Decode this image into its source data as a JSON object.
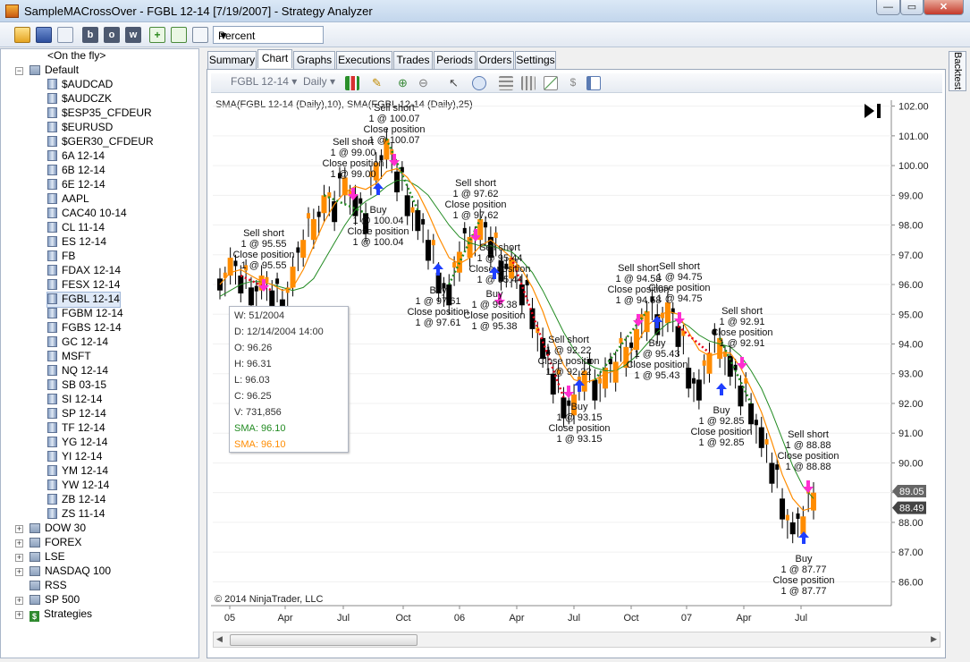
{
  "window": {
    "title": "SampleMACrossOver - FGBL 12-14 [7/19/2007] - Strategy Analyzer"
  },
  "toolbar": {
    "mode_select": "Percent",
    "b": "b",
    "o": "o",
    "w": "w"
  },
  "tree": {
    "on_the_fly": "<On the fly>",
    "default_label": "Default",
    "instruments": [
      "$AUDCAD",
      "$AUDCZK",
      "$ESP35_CFDEUR",
      "$EURUSD",
      "$GER30_CFDEUR",
      "6A 12-14",
      "6B 12-14",
      "6E 12-14",
      "AAPL",
      "CAC40 10-14",
      "CL 11-14",
      "ES 12-14",
      "FB",
      "FDAX 12-14",
      "FESX 12-14",
      "FGBL 12-14",
      "FGBM 12-14",
      "FGBS 12-14",
      "GC 12-14",
      "MSFT",
      "NQ 12-14",
      "SB 03-15",
      "SI 12-14",
      "SP 12-14",
      "TF 12-14",
      "YG 12-14",
      "YI 12-14",
      "YM 12-14",
      "YW 12-14",
      "ZB 12-14",
      "ZS 11-14"
    ],
    "groups": [
      "DOW 30",
      "FOREX",
      "LSE",
      "NASDAQ 100",
      "RSS",
      "SP 500",
      "Strategies"
    ],
    "selected": "FGBL 12-14"
  },
  "tabs": [
    "Summary",
    "Chart",
    "Graphs",
    "Executions",
    "Trades",
    "Periods",
    "Orders",
    "Settings"
  ],
  "active_tab": "Chart",
  "side_tab": "Backtest",
  "chart_toolbar": {
    "instrument": "FGBL 12-14",
    "interval": "Daily"
  },
  "chart_data": {
    "type": "line",
    "title": "SMA(FGBL 12-14 (Daily),10), SMA(FGBL 12-14 (Daily),25)",
    "copyright": "© 2014 NinjaTrader, LLC",
    "x_ticks": [
      "05",
      "Apr",
      "Jul",
      "Oct",
      "06",
      "Apr",
      "Jul",
      "Oct",
      "07",
      "Apr",
      "Jul"
    ],
    "y_ticks": [
      "102.00",
      "101.00",
      "100.00",
      "99.00",
      "98.00",
      "97.00",
      "96.00",
      "95.00",
      "94.00",
      "93.00",
      "92.00",
      "91.00",
      "90.00",
      "89.00",
      "88.00",
      "87.00",
      "86.00"
    ],
    "ylim": [
      85.5,
      102.5
    ],
    "price_markers": [
      "89.05",
      "88.49"
    ],
    "price": [
      96.2,
      96.9,
      96.3,
      95.9,
      96.3,
      95.8,
      95.5,
      96.6,
      97.5,
      98.2,
      99.0,
      98.8,
      99.6,
      99.0,
      98.4,
      100.1,
      100.9,
      99.8,
      99.0,
      98.5,
      97.5,
      96.4,
      96.0,
      97.1,
      97.6,
      98.2,
      97.6,
      96.8,
      96.9,
      96.0,
      95.2,
      94.2,
      93.0,
      92.2,
      92.3,
      93.1,
      92.8,
      93.2,
      93.4,
      93.9,
      94.5,
      95.1,
      95.0,
      95.4,
      94.6,
      93.2,
      92.8,
      93.7,
      94.2,
      93.6,
      92.6,
      92.0,
      91.2,
      90.0,
      88.8,
      88.0,
      88.2,
      89.0
    ],
    "price_ymin": [
      95.8,
      96.3,
      95.7,
      95.3,
      95.8,
      95.2,
      94.9,
      95.9,
      96.9,
      97.5,
      98.4,
      98.1,
      99.0,
      98.3,
      97.7,
      99.5,
      100.2,
      99.1,
      98.3,
      97.8,
      96.8,
      95.7,
      95.3,
      96.4,
      96.9,
      97.5,
      96.9,
      96.1,
      96.2,
      95.3,
      94.5,
      93.5,
      92.3,
      91.5,
      91.6,
      92.4,
      92.1,
      92.5,
      92.7,
      93.2,
      93.8,
      94.4,
      94.3,
      94.7,
      93.9,
      92.5,
      92.1,
      93.0,
      93.5,
      92.9,
      91.9,
      91.3,
      90.5,
      89.3,
      88.1,
      87.6,
      87.6,
      88.4
    ],
    "sma_10": [
      96.0,
      96.4,
      96.5,
      96.3,
      96.1,
      96.0,
      95.8,
      95.9,
      96.5,
      97.3,
      98.1,
      98.7,
      99.1,
      99.3,
      99.2,
      99.4,
      99.8,
      99.9,
      99.6,
      99.1,
      98.4,
      97.6,
      96.9,
      96.7,
      96.9,
      97.3,
      97.5,
      97.2,
      96.9,
      96.5,
      95.9,
      95.1,
      94.1,
      93.3,
      92.8,
      92.7,
      92.8,
      93.0,
      93.1,
      93.5,
      94.0,
      94.6,
      94.9,
      95.1,
      95.0,
      94.4,
      93.8,
      93.6,
      93.7,
      93.7,
      93.2,
      92.5,
      91.7,
      90.7,
      89.6,
      88.8,
      88.4,
      88.5
    ],
    "sma_25": [
      95.6,
      95.8,
      96.0,
      96.1,
      96.1,
      96.0,
      95.9,
      95.8,
      95.9,
      96.2,
      96.8,
      97.4,
      98.0,
      98.5,
      98.8,
      99.0,
      99.3,
      99.5,
      99.5,
      99.3,
      99.0,
      98.5,
      98.0,
      97.6,
      97.4,
      97.3,
      97.3,
      97.2,
      97.1,
      96.8,
      96.4,
      95.8,
      95.1,
      94.4,
      93.8,
      93.4,
      93.2,
      93.1,
      93.1,
      93.3,
      93.6,
      94.0,
      94.4,
      94.7,
      94.8,
      94.6,
      94.3,
      94.1,
      94.0,
      93.9,
      93.6,
      93.1,
      92.5,
      91.7,
      90.8,
      89.9,
      89.2,
      88.8
    ],
    "signals": [
      {
        "lines": [
          "Sell short",
          "1 @ 95.55",
          "Close position",
          "1 @ 95.55"
        ]
      },
      {
        "lines": [
          "Sell short",
          "1 @ 99.00",
          "Close position",
          "1 @ 99.00"
        ]
      },
      {
        "lines": [
          "Sell short",
          "1 @ 100.07",
          "Close position",
          "1 @ 100.07"
        ]
      },
      {
        "lines": [
          "Buy",
          "1 @ 100.04",
          "Close position",
          "1 @ 100.04"
        ]
      },
      {
        "lines": [
          "Sell short",
          "1 @ 97.62",
          "Close position",
          "1 @ 97.62"
        ]
      },
      {
        "lines": [
          "Buy",
          "1 @ 97.61",
          "Close position",
          "1 @ 97.61"
        ]
      },
      {
        "lines": [
          "Sell short",
          "1 @ 95.44",
          "Close position",
          "1 @ 95.44"
        ]
      },
      {
        "lines": [
          "Buy",
          "1 @ 95.38",
          "Close position",
          "1 @ 95.38"
        ]
      },
      {
        "lines": [
          "Sell short",
          "1 @ 92.22",
          "Close position",
          "1 @ 92.22"
        ]
      },
      {
        "lines": [
          "Buy",
          "1 @ 93.15",
          "Close position",
          "1 @ 93.15"
        ]
      },
      {
        "lines": [
          "Sell short",
          "1 @ 94.58",
          "Close position",
          "1 @ 94.58"
        ]
      },
      {
        "lines": [
          "Sell short",
          "1 @ 94.75",
          "Close position",
          "1 @ 94.75"
        ]
      },
      {
        "lines": [
          "Buy",
          "1 @ 95.43",
          "Close position",
          "1 @ 95.43"
        ]
      },
      {
        "lines": [
          "Sell short",
          "1 @ 92.91",
          "Close position",
          "1 @ 92.91"
        ]
      },
      {
        "lines": [
          "Buy",
          "1 @ 92.85",
          "Close position",
          "1 @ 92.85"
        ]
      },
      {
        "lines": [
          "Sell short",
          "1 @ 88.88",
          "Close position",
          "1 @ 88.88"
        ]
      },
      {
        "lines": [
          "Buy",
          "1 @ 87.77",
          "Close position",
          "1 @ 87.77"
        ]
      }
    ]
  },
  "tooltip": {
    "w": "W: 51/2004",
    "d": "D: 12/14/2004 14:00",
    "o": "O: 96.26",
    "h": "H: 96.31",
    "l": "L: 96.03",
    "c": "C: 96.25",
    "v": "V: 731,856",
    "sma1": "SMA: 96.10",
    "sma2": "SMA: 96.10"
  },
  "colors": {
    "price": "#000000",
    "up": "#ff8c00",
    "down": "#000000",
    "sma_10": "#ff8c00",
    "sma_25": "#228b22",
    "buy": "#1f3fff",
    "sell": "#ff2fd1",
    "win_trade": "#228b22",
    "loss_trade": "#e8001a"
  }
}
